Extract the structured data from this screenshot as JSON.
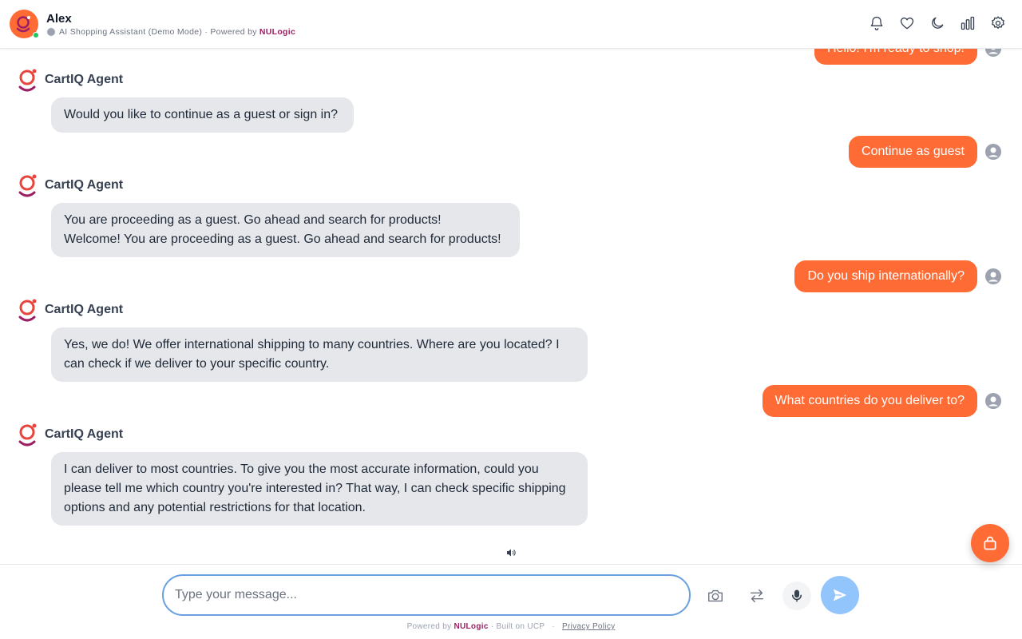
{
  "header": {
    "agent_name": "Alex",
    "subtitle": "AI Shopping Assistant (Demo Mode) · Powered by",
    "brand": "NULogic",
    "icons": [
      "bell-icon",
      "heart-icon",
      "moon-icon",
      "bar-chart-icon",
      "gear-icon"
    ]
  },
  "messages": {
    "top_user_partial": "Hello! I'm ready to shop!",
    "agent_name": "CartIQ Agent",
    "agent_1": "Would you like to continue as a guest or sign in?",
    "user_1": "Continue as guest",
    "agent_2_line1": "You are proceeding as a guest. Go ahead and search for products!",
    "agent_2_line2": "Welcome! You are proceeding as a guest. Go ahead and search for products!",
    "user_2": "Do you ship internationally?",
    "agent_3": "Yes, we do! We offer international shipping to many countries. Where are you located? I can check if we deliver to your specific country.",
    "user_3": "What countries do you deliver to?",
    "agent_4": "I can deliver to most countries. To give you the most accurate information, could you please tell me which country you're interested in? That way, I can check specific shipping options and any potential restrictions for that location."
  },
  "composer": {
    "placeholder": "Type your message...",
    "value": ""
  },
  "footer": {
    "powered_prefix": "Powered by",
    "brand": "NULogic",
    "built_on": "· Built on UCP",
    "dot": "·",
    "privacy": "Privacy Policy"
  },
  "colors": {
    "accent": "#ff6b35",
    "brand": "#9d1f63",
    "agent_bubble": "#e5e7eb",
    "send_button": "#93c5fd"
  }
}
